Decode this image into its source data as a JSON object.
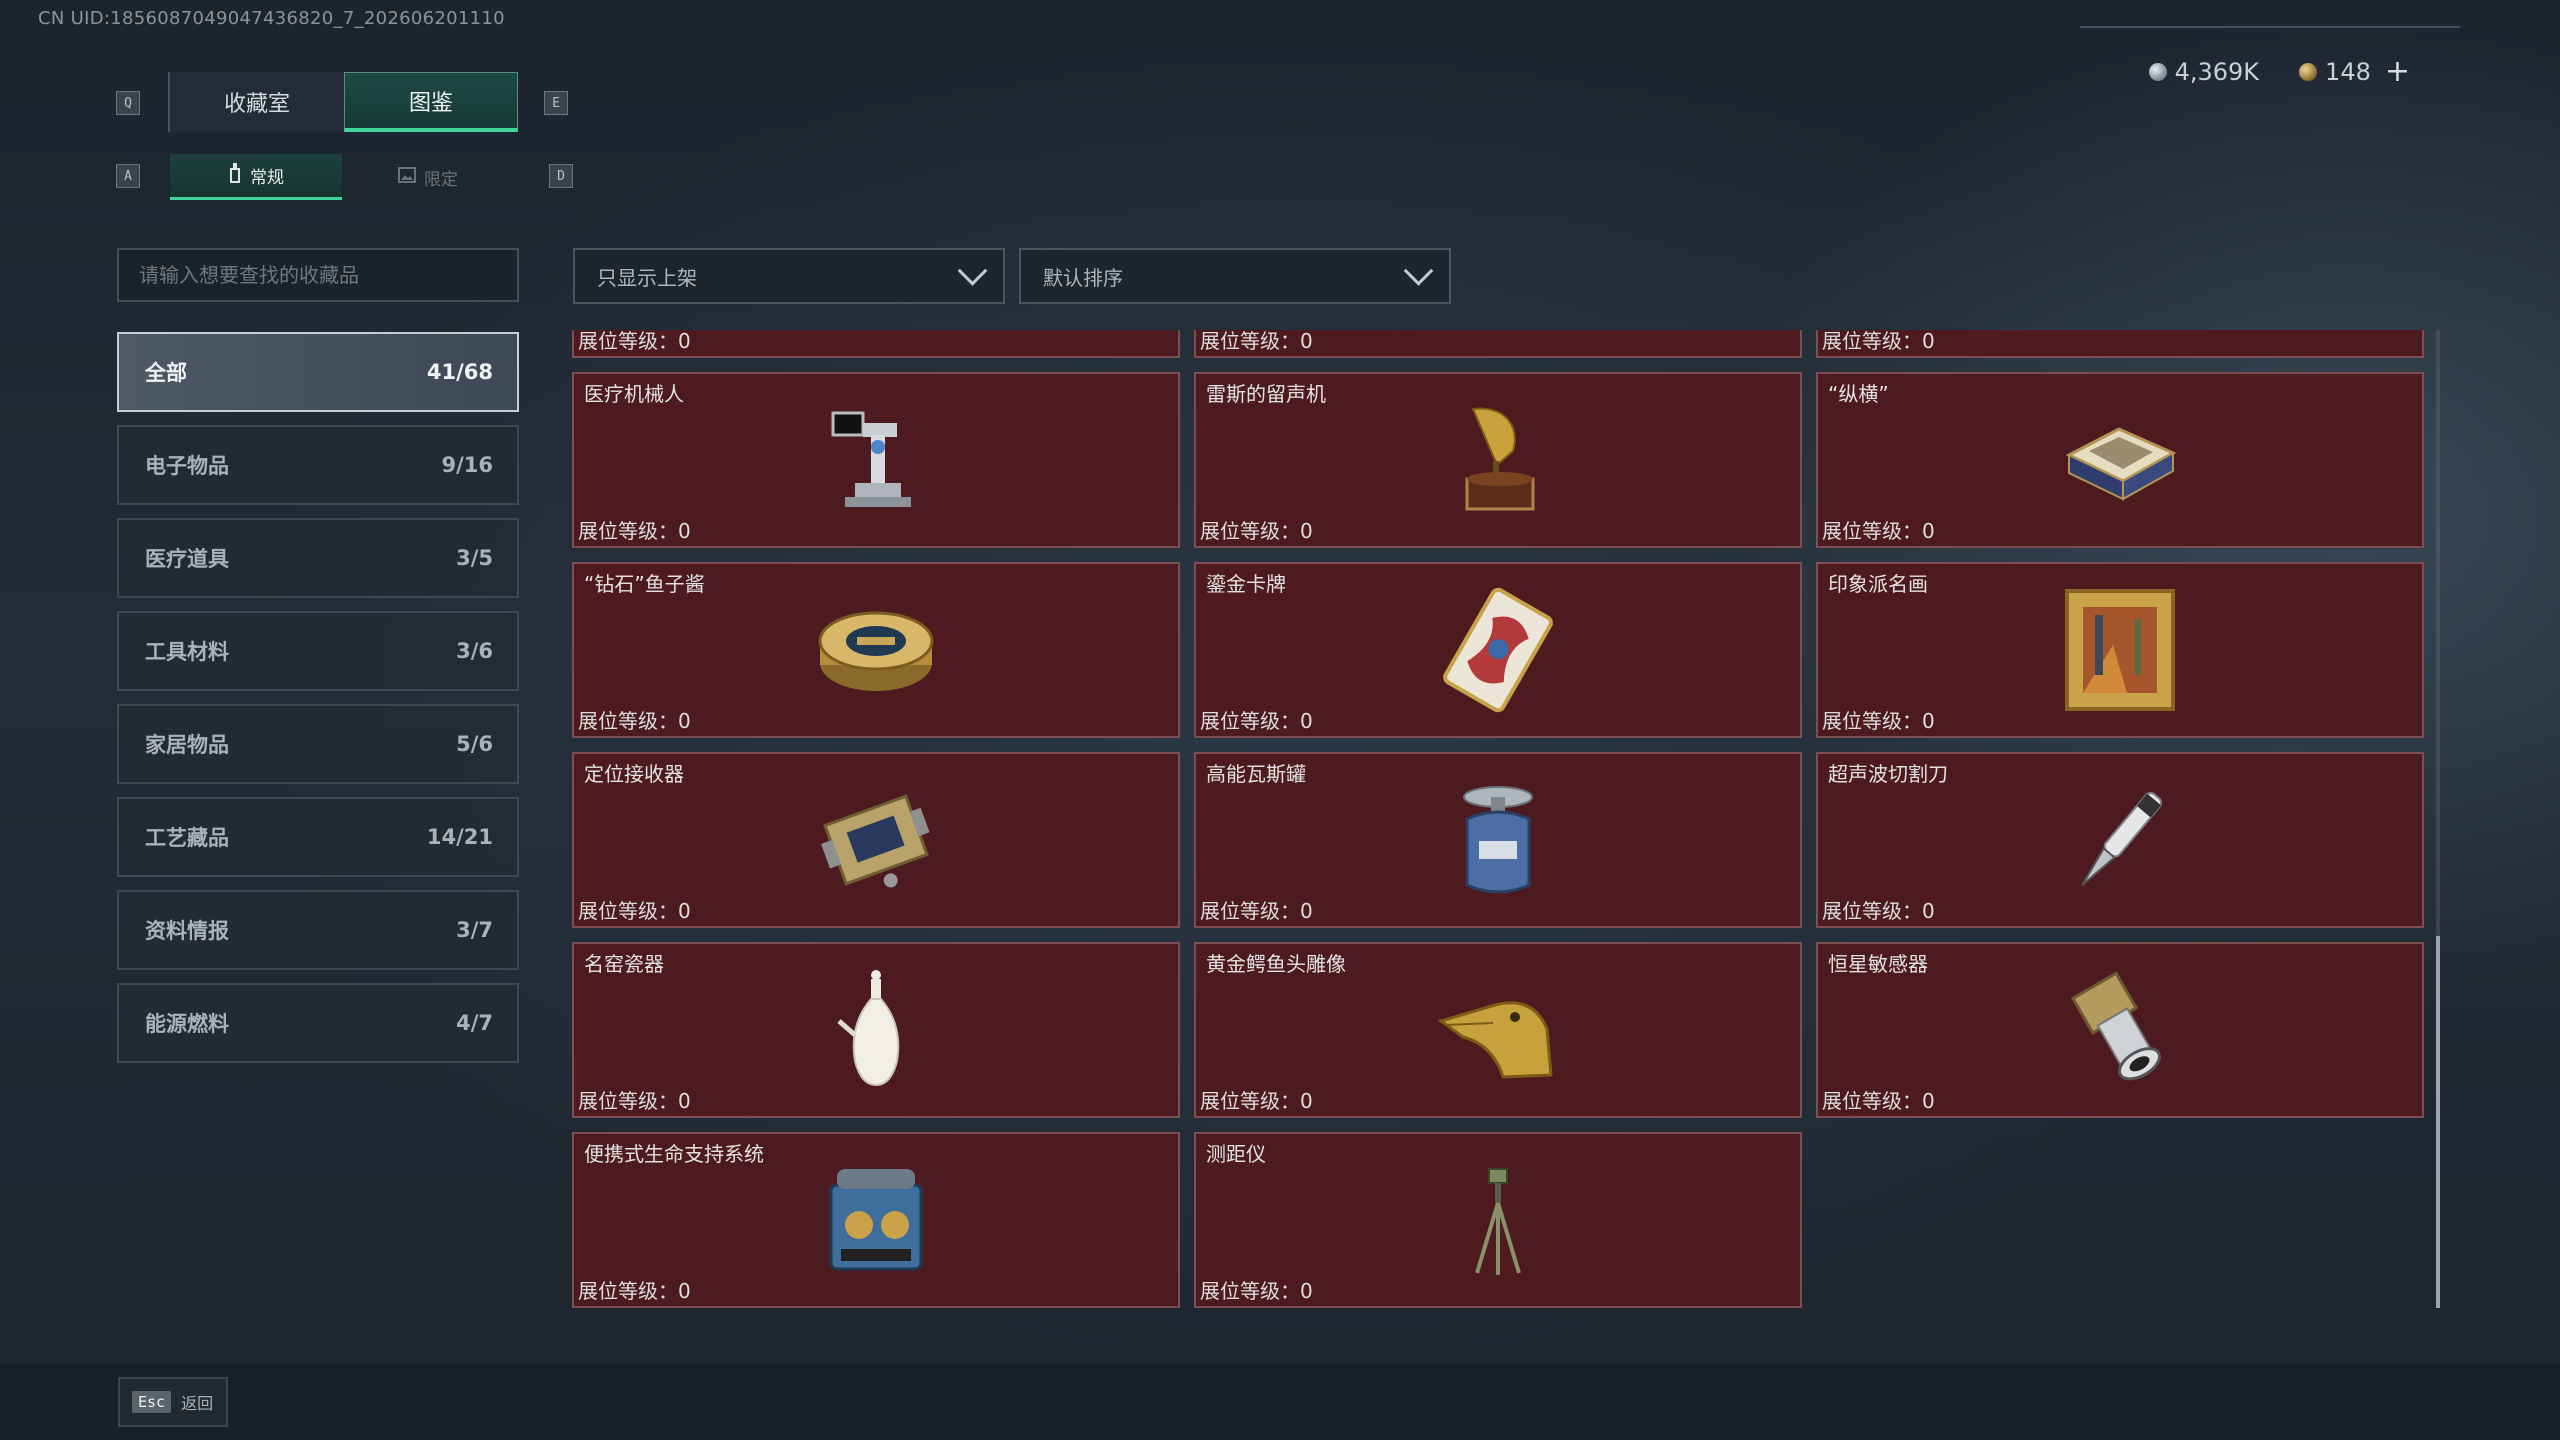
{
  "uid": "CN UID:1856087049047436820_7_202606201110",
  "currency": [
    {
      "icon": "silver-coin-icon",
      "value": "4,369K"
    },
    {
      "icon": "gold-coin-icon",
      "value": "148"
    }
  ],
  "currency_plus": "+",
  "keys": {
    "prev_tab": "Q",
    "next_tab": "E",
    "prev_sub": "A",
    "next_sub": "D"
  },
  "tabs": [
    {
      "label": "收藏室",
      "active": false
    },
    {
      "label": "图鉴",
      "active": true
    }
  ],
  "subtabs": [
    {
      "label": "常规",
      "icon": "bottle-icon",
      "active": true
    },
    {
      "label": "限定",
      "icon": "image-icon",
      "active": false
    }
  ],
  "search": {
    "placeholder": "请输入想要查找的收藏品",
    "value": ""
  },
  "filters": [
    {
      "value": "只显示上架",
      "icon": "chevron-down-icon"
    },
    {
      "value": "默认排序",
      "icon": "chevron-down-icon"
    }
  ],
  "categories": [
    {
      "label": "全部",
      "count": "41/68",
      "active": true
    },
    {
      "label": "电子物品",
      "count": "9/16",
      "active": false
    },
    {
      "label": "医疗道具",
      "count": "3/5",
      "active": false
    },
    {
      "label": "工具材料",
      "count": "3/6",
      "active": false
    },
    {
      "label": "家居物品",
      "count": "5/6",
      "active": false
    },
    {
      "label": "工艺藏品",
      "count": "14/21",
      "active": false
    },
    {
      "label": "资料情报",
      "count": "3/7",
      "active": false
    },
    {
      "label": "能源燃料",
      "count": "4/7",
      "active": false
    }
  ],
  "level_label": "展位等级：0",
  "items": [
    {
      "name": "",
      "icon": "collectible-icon"
    },
    {
      "name": "",
      "icon": "collectible-icon"
    },
    {
      "name": "",
      "icon": "collectible-icon"
    },
    {
      "name": "医疗机械人",
      "icon": "medical-robot-icon"
    },
    {
      "name": "雷斯的留声机",
      "icon": "gramophone-icon"
    },
    {
      "name": "“纵横”",
      "icon": "chess-box-icon"
    },
    {
      "name": "“钻石”鱼子酱",
      "icon": "caviar-tin-icon"
    },
    {
      "name": "鎏金卡牌",
      "icon": "gilded-card-icon"
    },
    {
      "name": "印象派名画",
      "icon": "framed-painting-icon"
    },
    {
      "name": "定位接收器",
      "icon": "receiver-icon"
    },
    {
      "name": "高能瓦斯罐",
      "icon": "gas-canister-icon"
    },
    {
      "name": "超声波切割刀",
      "icon": "ultrasonic-knife-icon"
    },
    {
      "name": "名窑瓷器",
      "icon": "porcelain-vase-icon"
    },
    {
      "name": "黄金鳄鱼头雕像",
      "icon": "crocodile-statue-icon"
    },
    {
      "name": "恒星敏感器",
      "icon": "star-sensor-icon"
    },
    {
      "name": "便携式生命支持系统",
      "icon": "life-support-icon"
    },
    {
      "name": "测距仪",
      "icon": "rangefinder-icon"
    }
  ],
  "esc": {
    "key": "Esc",
    "label": "返回"
  }
}
